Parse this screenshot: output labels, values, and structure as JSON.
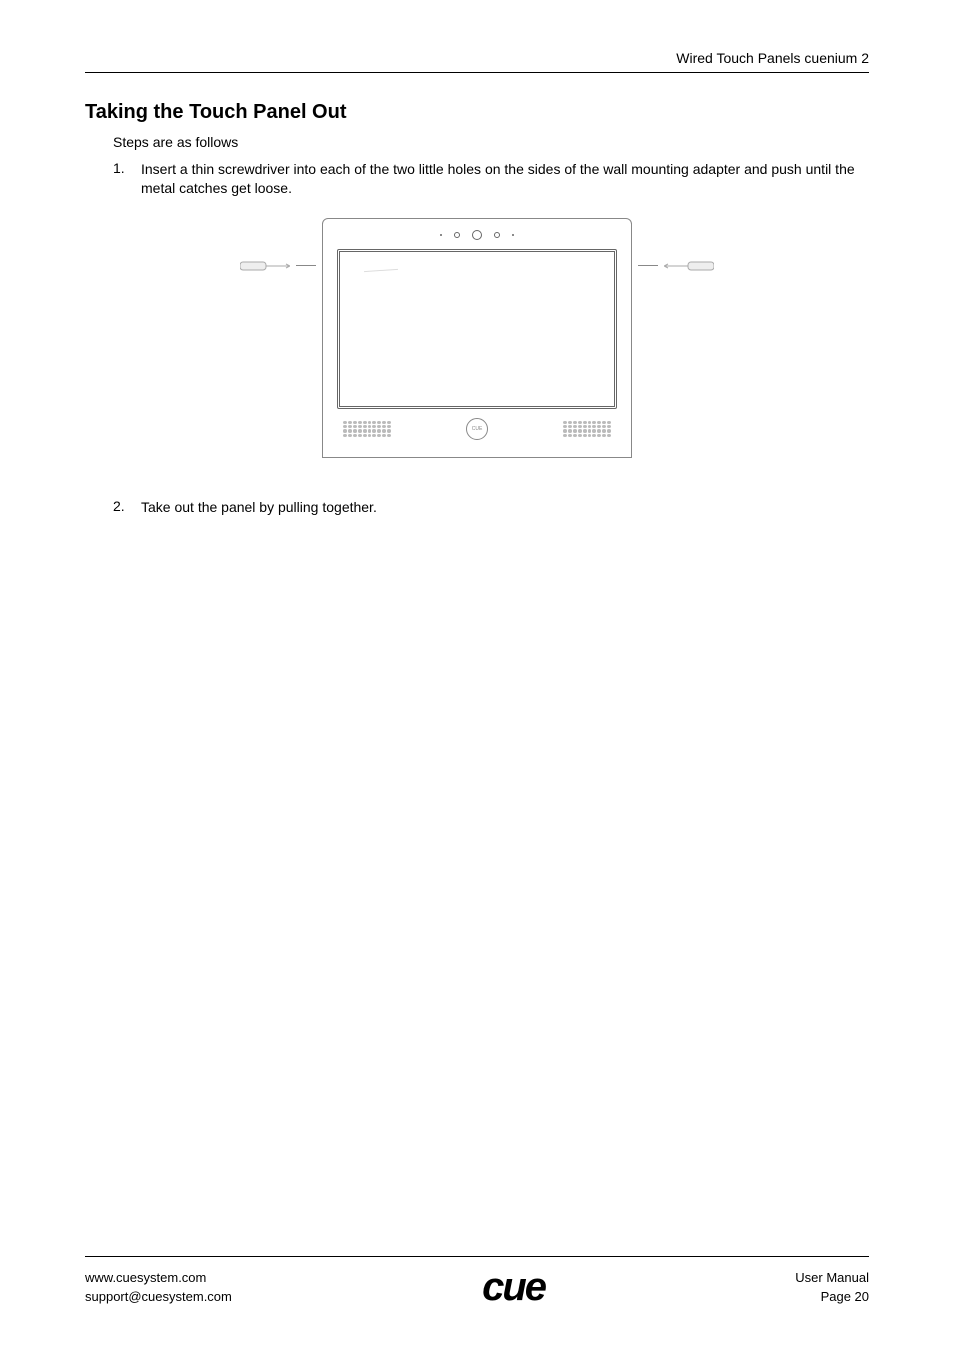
{
  "header": {
    "title": "Wired Touch Panels cuenium 2"
  },
  "section": {
    "title": "Taking the Touch Panel Out",
    "intro": "Steps are as follows",
    "steps": [
      {
        "num": "1.",
        "text": "Insert a thin screwdriver into each of the two little holes on the sides of the wall mounting adapter and push until the metal catches get loose."
      },
      {
        "num": "2.",
        "text": "Take out the panel by pulling together."
      }
    ]
  },
  "diagram": {
    "home_label": "CUE"
  },
  "footer": {
    "website": "www.cuesystem.com",
    "email": "support@cuesystem.com",
    "logo_text": "cue",
    "doc_type": "User Manual",
    "page_label": "Page 20"
  }
}
